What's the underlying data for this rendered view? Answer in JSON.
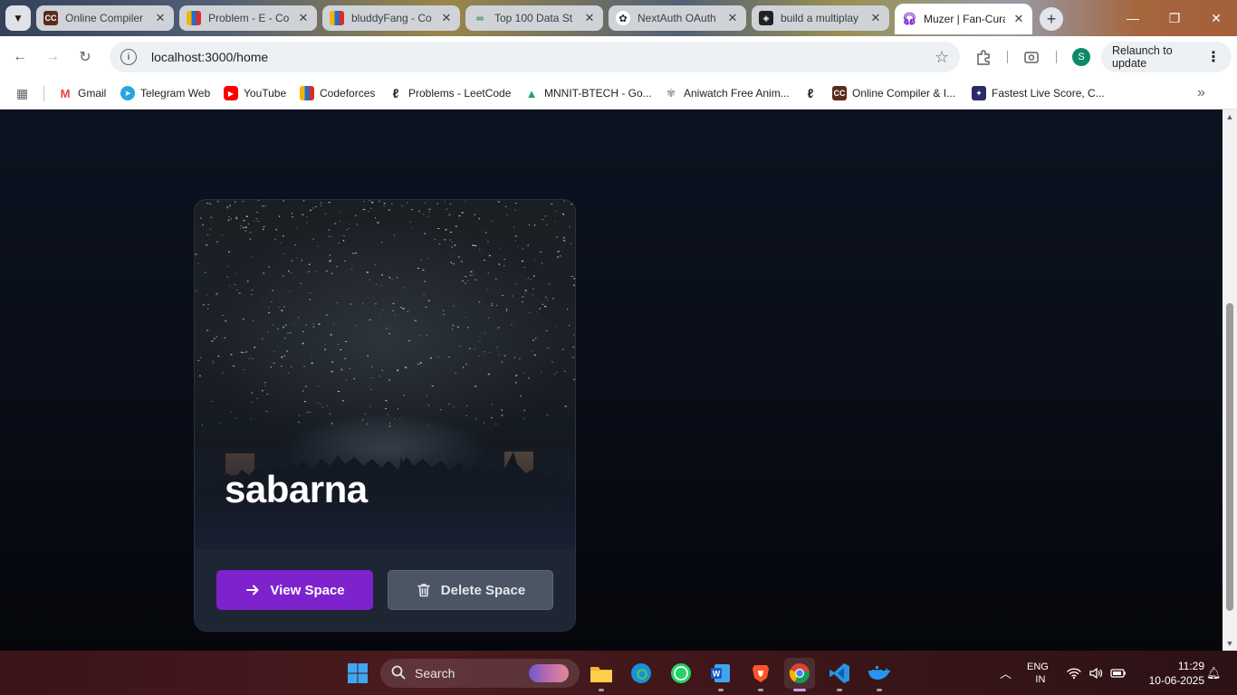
{
  "browser": {
    "tabs": [
      {
        "title": "Online Compiler",
        "favicon": "cc-favicon",
        "color": "#5a2a1a",
        "active": false
      },
      {
        "title": "Problem - E - Co",
        "favicon": "codeforces-favicon",
        "color": "#1f6fd0",
        "active": false
      },
      {
        "title": "bluddyFang - Co",
        "favicon": "codeforces-favicon",
        "color": "#e0a020",
        "active": false
      },
      {
        "title": "Top 100 Data St",
        "favicon": "gfg-favicon",
        "color": "#2f8d46",
        "active": false
      },
      {
        "title": "NextAuth OAuth",
        "favicon": "openai-favicon",
        "color": "#444444",
        "active": false
      },
      {
        "title": "build a multiplay",
        "favicon": "app-favicon",
        "color": "#222222",
        "active": false
      },
      {
        "title": "Muzer | Fan-Cura",
        "favicon": "headphones-favicon",
        "color": "#7e22ce",
        "active": true
      }
    ],
    "url": "localhost:3000/home",
    "relaunch_label": "Relaunch to update",
    "profile_initial": "S",
    "bookmarks": [
      {
        "label": "Gmail",
        "icon": "gmail-icon",
        "color": "#ea4335"
      },
      {
        "label": "Telegram Web",
        "icon": "telegram-icon",
        "color": "#2aa3e0"
      },
      {
        "label": "YouTube",
        "icon": "youtube-icon",
        "color": "#ff0000"
      },
      {
        "label": "Codeforces",
        "icon": "codeforces-icon",
        "color": "#1f6fd0"
      },
      {
        "label": "Problems - LeetCode",
        "icon": "leetcode-icon",
        "color": "#f0a020"
      },
      {
        "label": "MNNIT-BTECH - Go...",
        "icon": "google-drive-icon",
        "color": "#1fa463"
      },
      {
        "label": "Aniwatch Free Anim...",
        "icon": "aniwatch-icon",
        "color": "#9a9a9a"
      },
      {
        "label": "",
        "icon": "leetcode-icon",
        "color": "#f0a020"
      },
      {
        "label": "Online Compiler & I...",
        "icon": "cc-icon",
        "color": "#5a2a1a"
      },
      {
        "label": "Fastest Live Score, C...",
        "icon": "cricbuzz-icon",
        "color": "#2a2a6a"
      }
    ]
  },
  "page": {
    "space_card": {
      "title": "sabarna",
      "view_label": "View Space",
      "delete_label": "Delete Space"
    }
  },
  "taskbar": {
    "search_placeholder": "Search",
    "lang_line1": "ENG",
    "lang_line2": "IN",
    "time": "11:29",
    "date": "10-06-2025"
  },
  "colors": {
    "accent_purple": "#7e22ce",
    "delete_gray": "#4b5563",
    "page_bg": "#0a0f1a"
  }
}
